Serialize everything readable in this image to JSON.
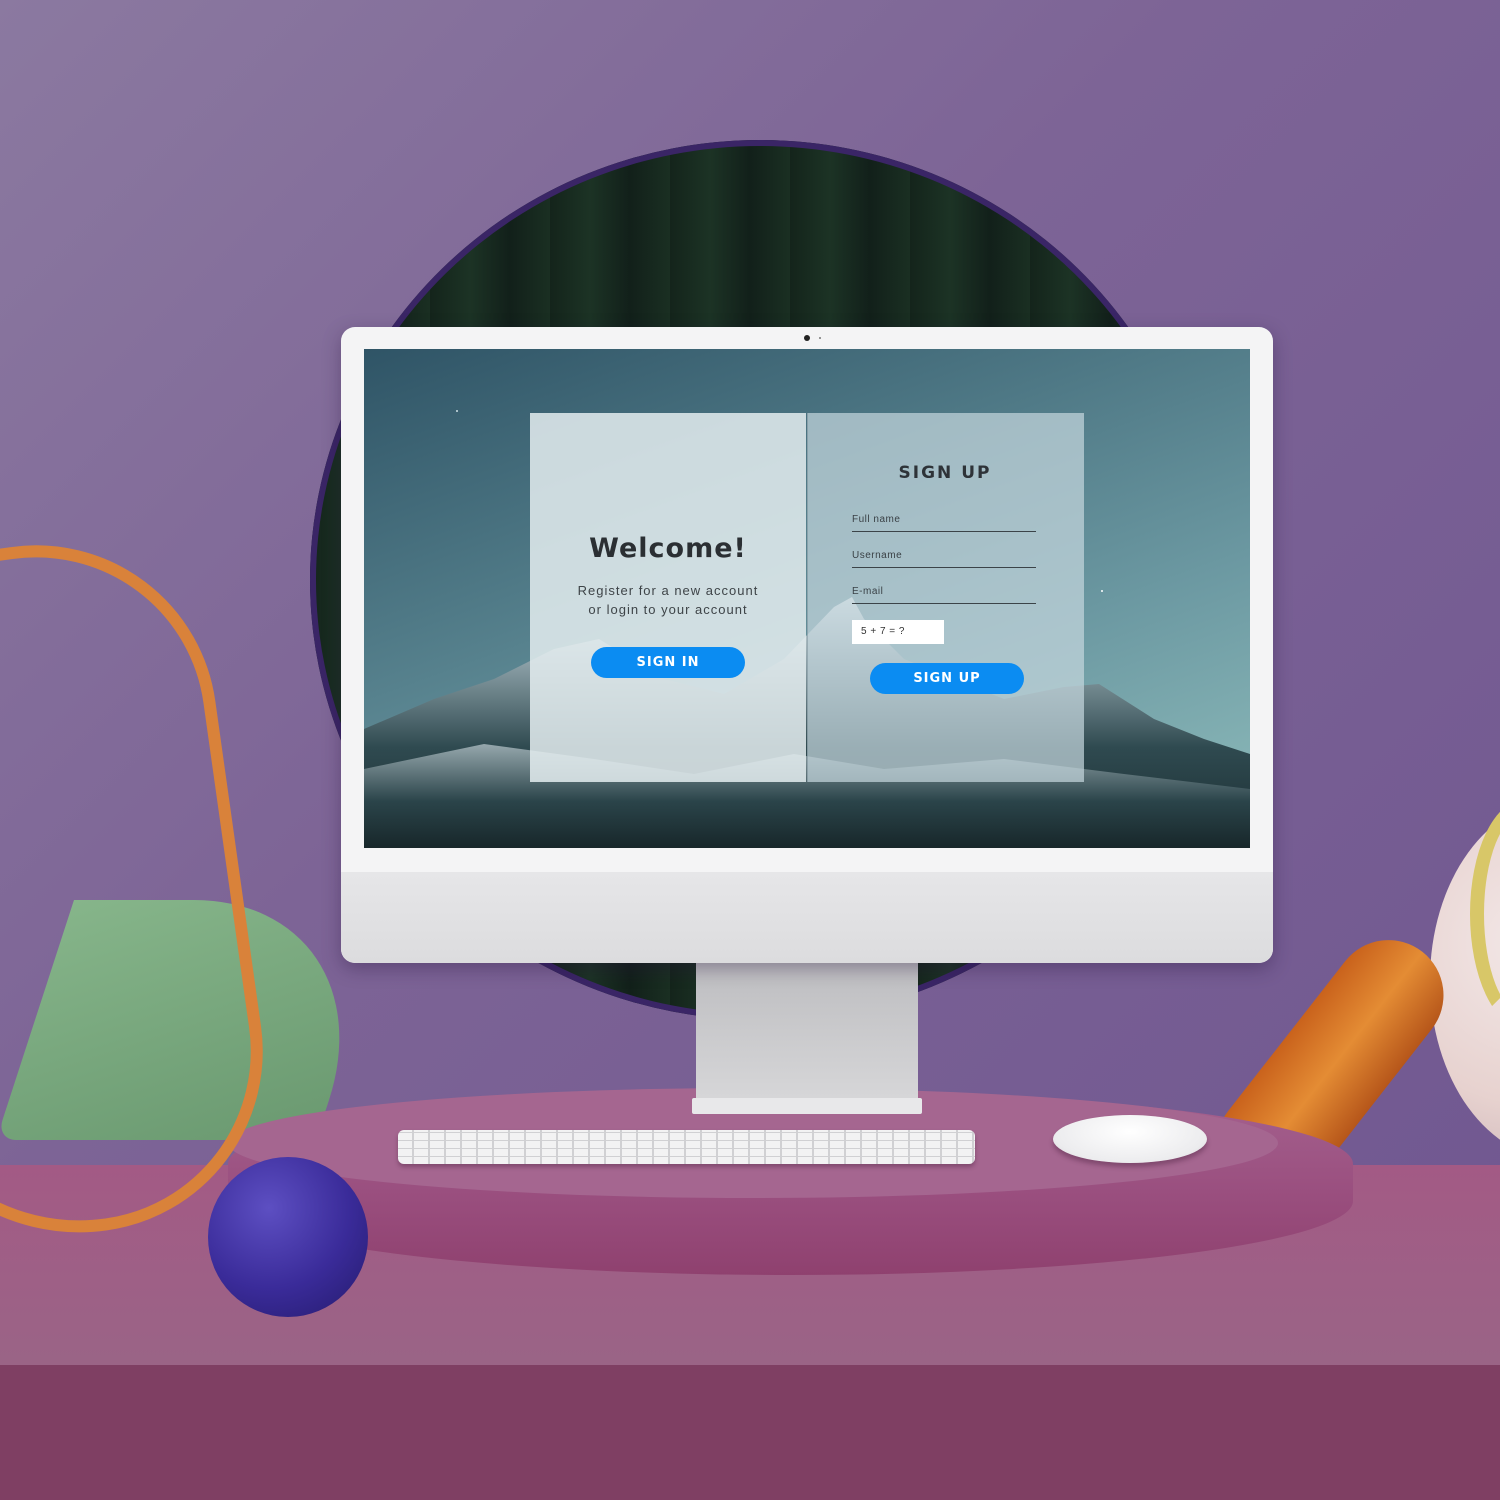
{
  "login_page": {
    "welcome": {
      "title": "Welcome!",
      "subtitle_line1": "Register for a new account",
      "subtitle_line2": "or login to your account",
      "sign_in_label": "SIGN IN"
    },
    "signup": {
      "title": "SIGN UP",
      "fields": [
        {
          "placeholder": "Full name"
        },
        {
          "placeholder": "Username"
        },
        {
          "placeholder": "E-mail"
        }
      ],
      "captcha": "5 + 7 = ?",
      "submit_label": "SIGN UP"
    }
  },
  "colors": {
    "accent_button": "#0b8cf2",
    "wall": "#7d6496",
    "table": "#9a4f7f"
  }
}
